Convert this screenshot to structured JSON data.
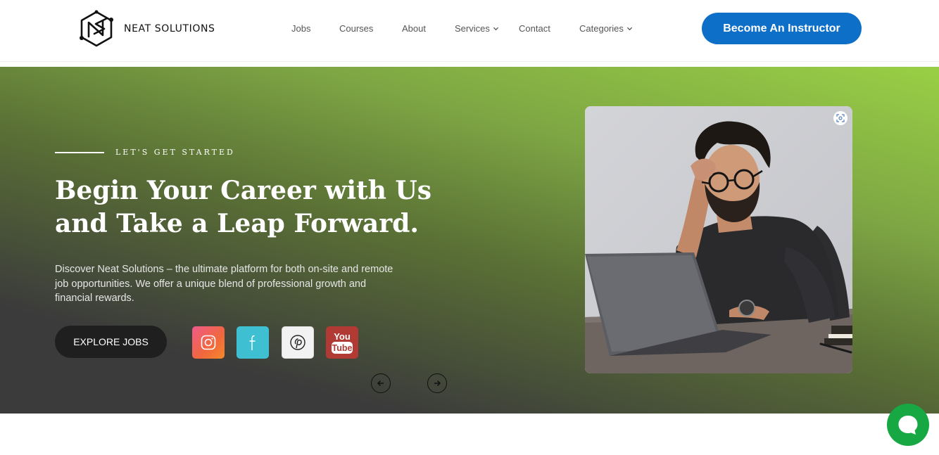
{
  "header": {
    "logo": {
      "text": "NEAT SOLUTIONS",
      "icon": "ns-monogram-logo"
    },
    "nav": [
      {
        "label": "Jobs",
        "has_dropdown": false
      },
      {
        "label": "Courses",
        "has_dropdown": false
      },
      {
        "label": "About",
        "has_dropdown": false
      },
      {
        "label": "Services",
        "has_dropdown": true
      },
      {
        "label": "Contact",
        "has_dropdown": false
      },
      {
        "label": "Categories",
        "has_dropdown": true
      }
    ],
    "cta_label": "Become An Instructor"
  },
  "hero": {
    "eyebrow": "LET'S GET STARTED",
    "title_line1": "Begin Your Career with Us",
    "title_line2": "and Take a Leap Forward.",
    "description": "Discover Neat Solutions – the ultimate platform for both on-site and remote job opportunities. We offer a unique blend of professional growth and financial rewards.",
    "explore_label": "EXPLORE JOBS",
    "socials": [
      {
        "name": "instagram",
        "icon": "instagram-icon"
      },
      {
        "name": "facebook",
        "icon": "facebook-icon"
      },
      {
        "name": "pinterest",
        "icon": "pinterest-icon"
      },
      {
        "name": "youtube",
        "icon": "youtube-icon",
        "text_top": "You",
        "text_bottom": "Tube"
      }
    ],
    "slider_prev": "←",
    "slider_next": "→",
    "image_alt": "man with glasses working on laptop"
  },
  "chat": {
    "icon": "chat-bubble-icon"
  },
  "colors": {
    "brand_blue": "#0d6fc8",
    "hero_green": "#99cf45",
    "hero_dark": "#3b3b3b",
    "chat_green": "#17a844"
  }
}
